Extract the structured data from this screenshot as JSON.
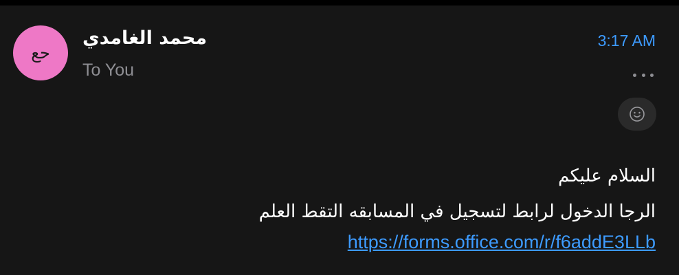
{
  "message": {
    "avatar_initials": "حع",
    "sender_name": "محمد الغامدي",
    "recipient": "To You",
    "time": "3:17 AM",
    "more_icon": "more-horizontal-icon",
    "reaction_icon": "smiley-icon",
    "body_lines": [
      "السلام عليكم",
      "الرجا الدخول لرابط لتسجيل في المسابقه التقط العلم"
    ],
    "link": "https://forms.office.com/r/f6addE3LLb"
  },
  "colors": {
    "background": "#000000",
    "card": "#161616",
    "avatar": "#EE78C6",
    "accent": "#3D9BFF",
    "secondary_text": "#8e8e93",
    "primary_text": "#ffffff",
    "reaction_bg": "#2a2a2a"
  }
}
